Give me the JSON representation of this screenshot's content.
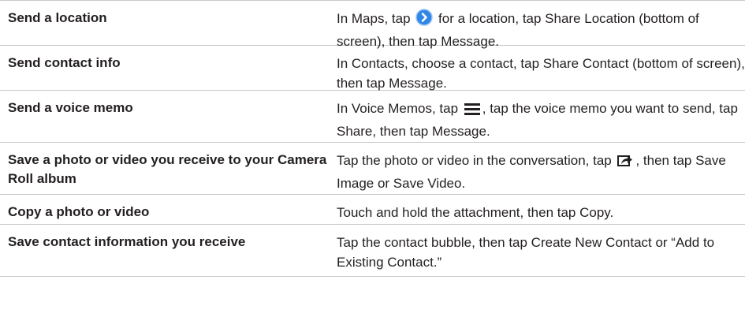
{
  "rows": [
    {
      "action": "Send a location",
      "instruction": {
        "before": "In Maps, tap",
        "icon": "disclosure-arrow-icon",
        "after": "for a location, tap Share Location (bottom of screen), then tap Message."
      }
    },
    {
      "action": "Send contact info",
      "instruction": {
        "before": "In Contacts, choose a contact, tap Share Contact (bottom of screen), then tap Message."
      }
    },
    {
      "action": "Send a voice memo",
      "instruction": {
        "before": "In Voice Memos, tap",
        "icon": "list-icon",
        "after": ", tap the voice memo you want to send, tap Share, then tap Message."
      }
    },
    {
      "action": "Save a photo or video you receive to your Camera Roll album",
      "instruction": {
        "before": "Tap the photo or video in the conversation, tap",
        "icon": "share-icon",
        "after": ", then tap Save Image or Save Video."
      }
    },
    {
      "action": "Copy a photo or video",
      "instruction": {
        "before": "Touch and hold the attachment, then tap Copy."
      }
    },
    {
      "action": "Save contact information you receive",
      "instruction": {
        "before": "Tap the contact bubble, then tap Create New Contact or “Add to Existing Contact.”"
      }
    }
  ],
  "colors": {
    "text": "#231f20",
    "rule": "#c8c8c8",
    "icon_blue": "#2f86e6"
  }
}
